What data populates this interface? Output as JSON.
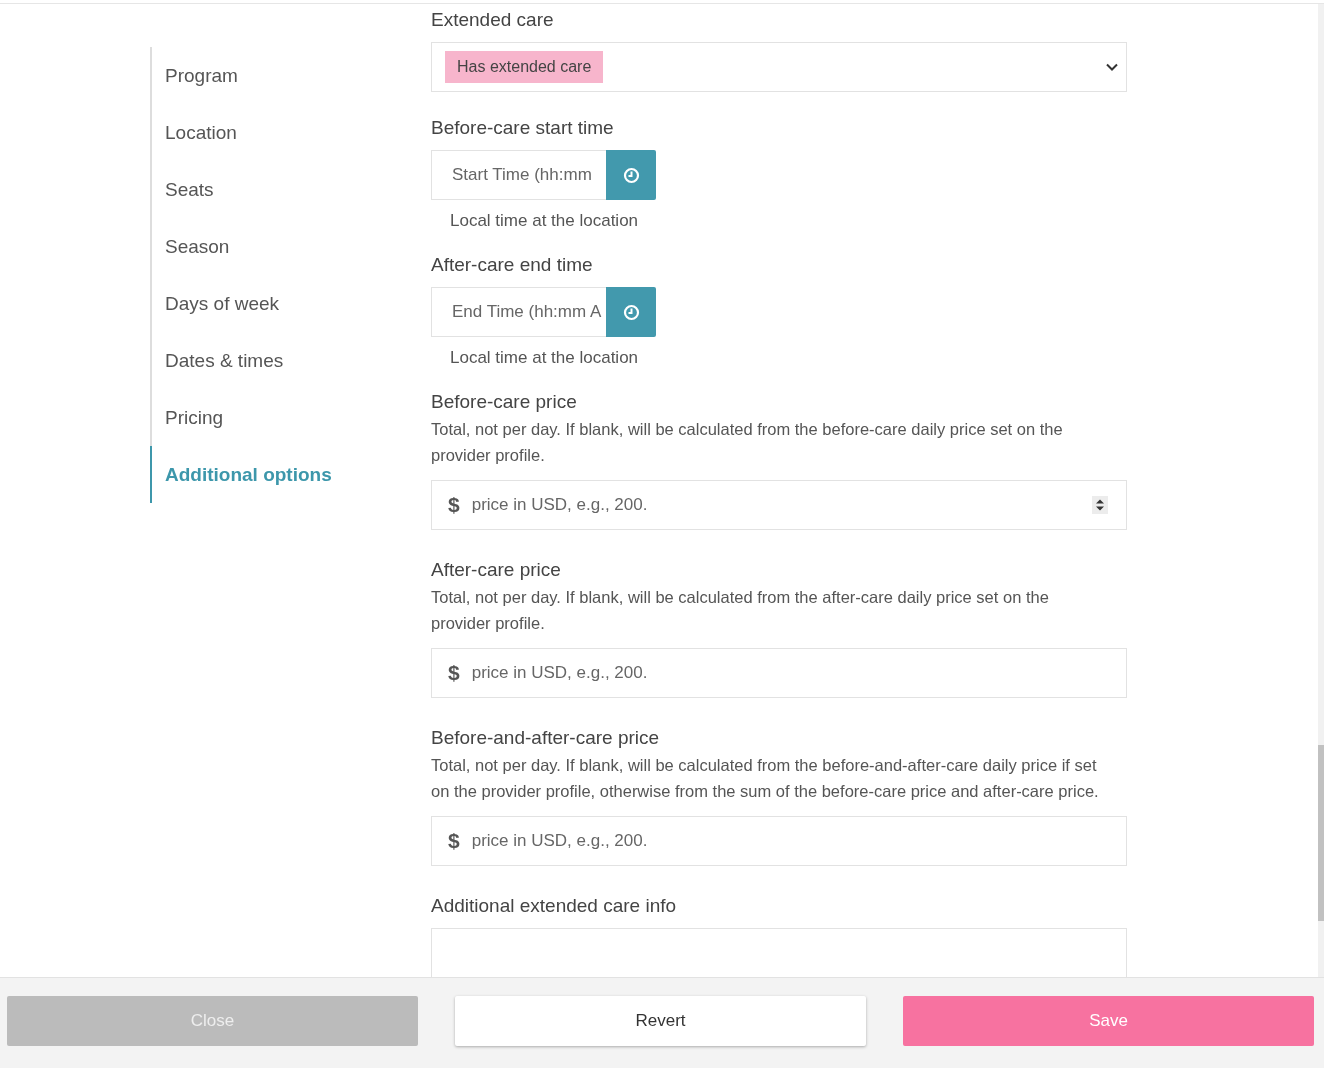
{
  "sidebar": {
    "items": [
      {
        "label": "Program",
        "selected": false
      },
      {
        "label": "Location",
        "selected": false
      },
      {
        "label": "Seats",
        "selected": false
      },
      {
        "label": "Season",
        "selected": false
      },
      {
        "label": "Days of week",
        "selected": false
      },
      {
        "label": "Dates & times",
        "selected": false
      },
      {
        "label": "Pricing",
        "selected": false
      },
      {
        "label": "Additional options",
        "selected": true
      }
    ]
  },
  "fields": [
    {
      "kind": "select",
      "label": "Extended care",
      "value": "Has extended care"
    },
    {
      "kind": "time",
      "label": "Before-care start time",
      "placeholder": "Start Time (hh:mm",
      "hint": "Local time at the location"
    },
    {
      "kind": "time",
      "label": "After-care end time",
      "placeholder": "End Time (hh:mm A",
      "hint": "Local time at the location"
    },
    {
      "kind": "price",
      "label": "Before-care price",
      "help": "Total, not per day. If blank, will be calculated from the before-care daily price set on the provider profile.",
      "symbol": "$",
      "placeholder": "price in USD, e.g., 200.",
      "spinner": true
    },
    {
      "kind": "price",
      "label": "After-care price",
      "help": "Total, not per day. If blank, will be calculated from the after-care daily price set on the provider profile.",
      "symbol": "$",
      "placeholder": "price in USD, e.g., 200.",
      "spinner": false
    },
    {
      "kind": "price",
      "label": "Before-and-after-care price",
      "help": "Total, not per day. If blank, will be calculated from the before-and-after-care daily price if set on the provider profile, otherwise from the sum of the before-care price and after-care price.",
      "symbol": "$",
      "placeholder": "price in USD, e.g., 200.",
      "spinner": false
    },
    {
      "kind": "textarea",
      "label": "Additional extended care info"
    }
  ],
  "footer": {
    "buttons": [
      {
        "kind": "close",
        "label": "Close"
      },
      {
        "kind": "revert",
        "label": "Revert"
      },
      {
        "kind": "save",
        "label": "Save"
      }
    ]
  }
}
